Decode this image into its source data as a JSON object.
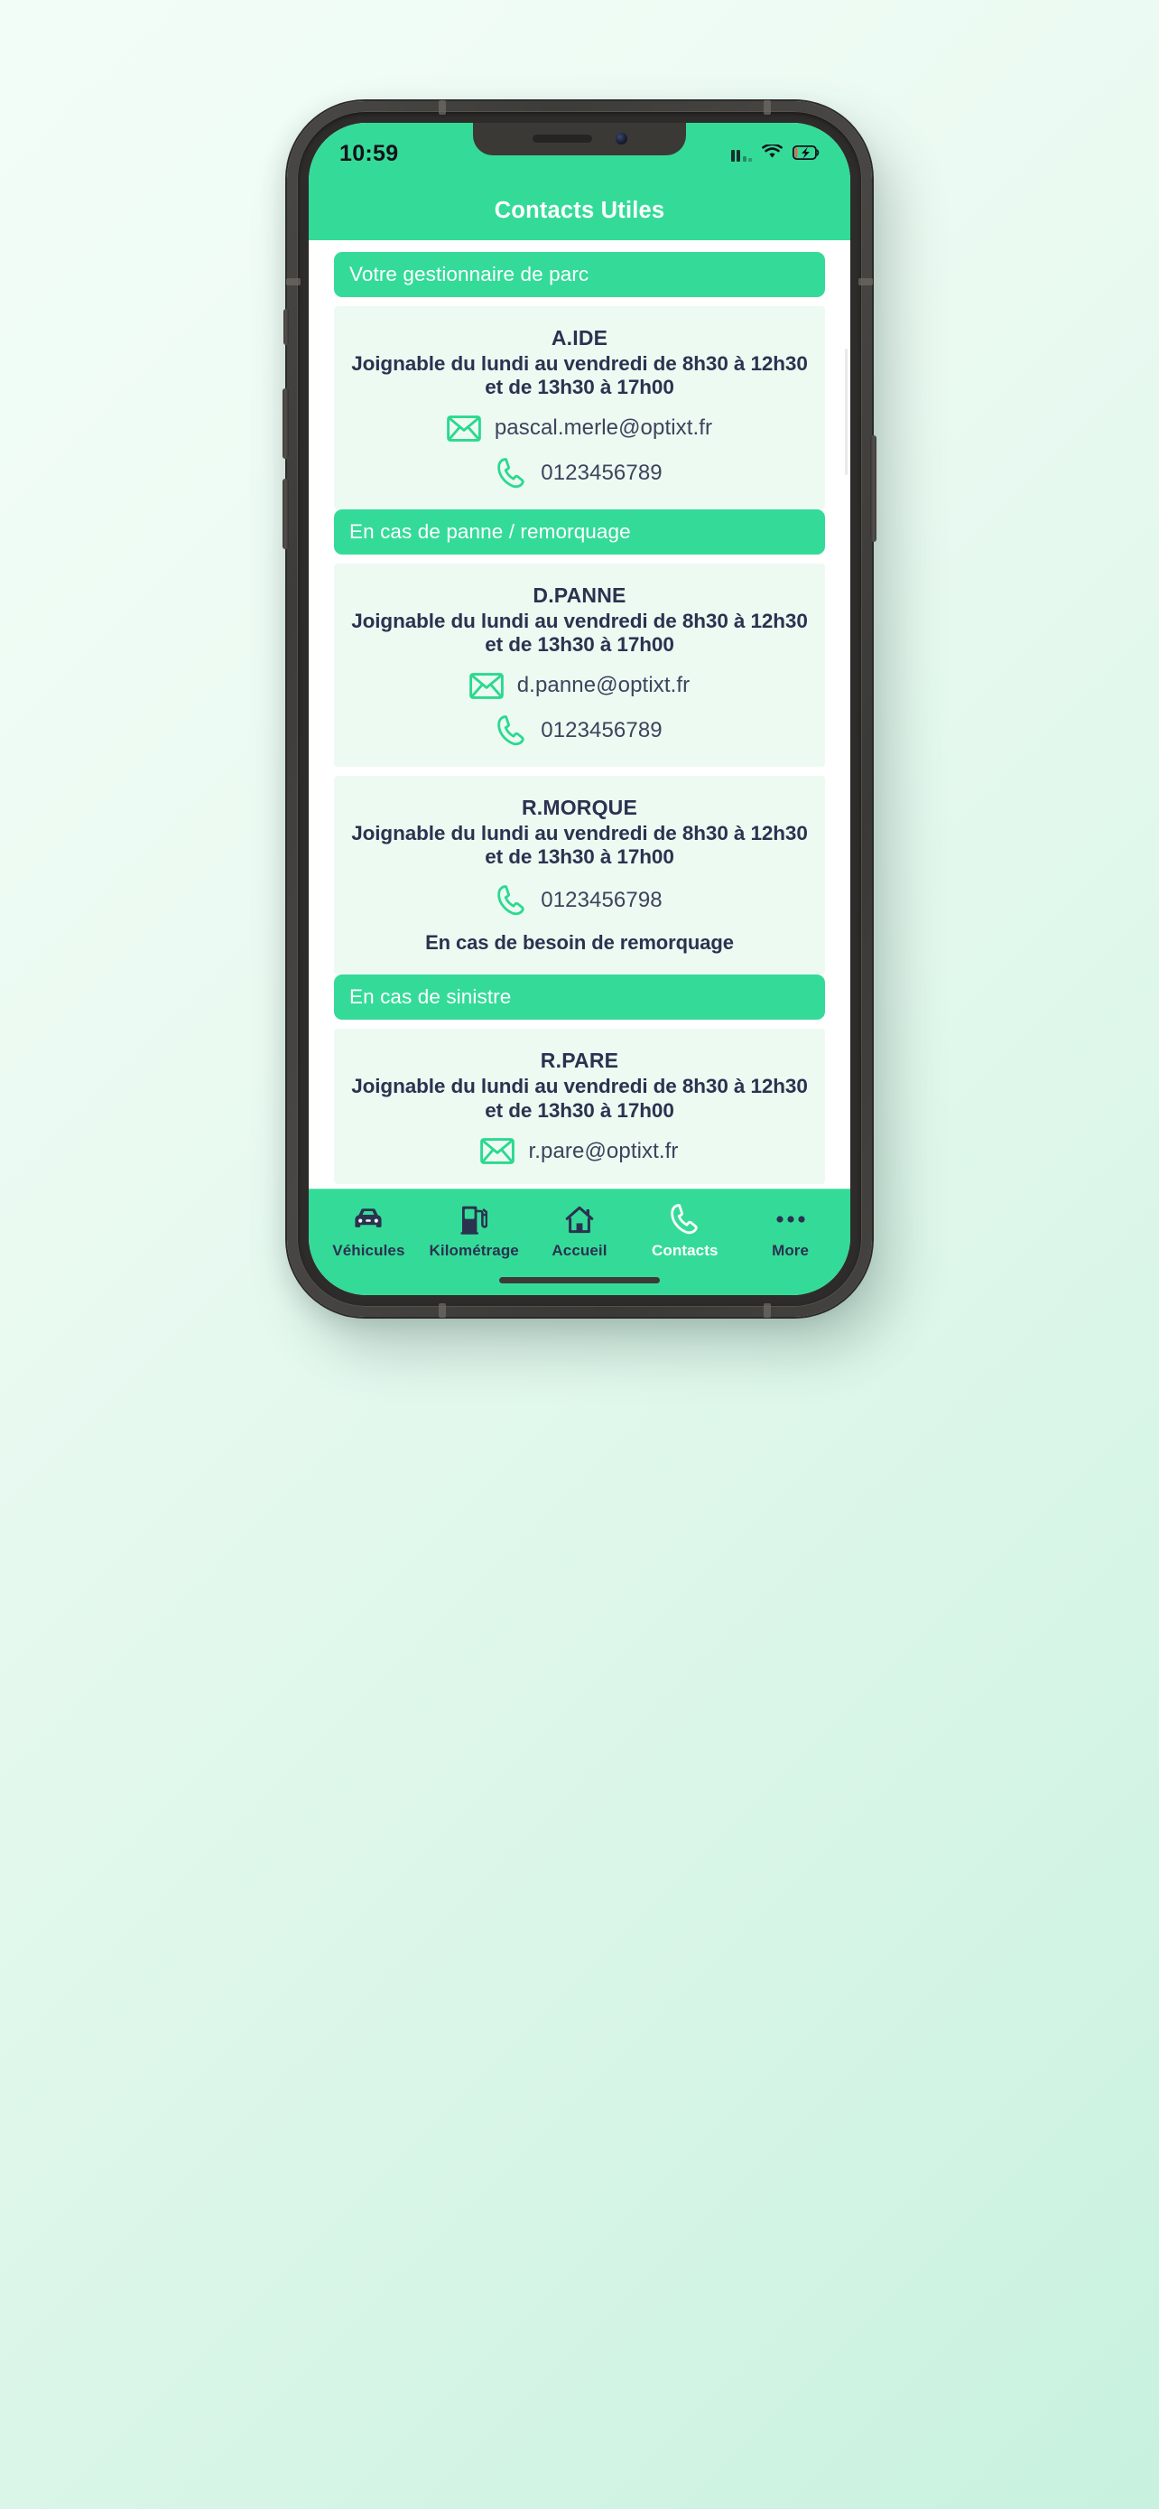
{
  "status_bar": {
    "time": "10:59",
    "signal_icon": "cellular-signal-icon",
    "wifi_icon": "wifi-icon",
    "battery_icon": "battery-charging-icon"
  },
  "header": {
    "title": "Contacts Utiles"
  },
  "colors": {
    "brand_green": "#34db98",
    "card_background": "#edfaf2",
    "text_dark": "#2b3250",
    "text_body": "#3d435c",
    "page_background": "#ffffff"
  },
  "sections": [
    {
      "label": "Votre gestionnaire de parc",
      "cards": [
        {
          "name": "A.IDE",
          "hours": "Joignable du lundi au vendredi de 8h30 à 12h30 et de 13h30 à 17h00",
          "rows": [
            {
              "icon": "envelope-icon",
              "type": "email",
              "value": "pascal.merle@optixt.fr"
            },
            {
              "icon": "phone-icon",
              "type": "phone",
              "value": "0123456789"
            }
          ],
          "note": ""
        }
      ]
    },
    {
      "label": "En cas de panne / remorquage",
      "cards": [
        {
          "name": "D.PANNE",
          "hours": "Joignable du lundi au vendredi de 8h30 à 12h30 et de 13h30 à 17h00",
          "rows": [
            {
              "icon": "envelope-icon",
              "type": "email",
              "value": "d.panne@optixt.fr"
            },
            {
              "icon": "phone-icon",
              "type": "phone",
              "value": "0123456789"
            }
          ],
          "note": ""
        },
        {
          "name": "R.MORQUE",
          "hours": "Joignable du lundi au vendredi de 8h30 à 12h30 et de 13h30 à 17h00",
          "rows": [
            {
              "icon": "phone-icon",
              "type": "phone",
              "value": "0123456798"
            }
          ],
          "note": "En cas de besoin de remorquage"
        }
      ]
    },
    {
      "label": "En cas de sinistre",
      "cards": [
        {
          "name": "R.PARE",
          "hours": "Joignable du lundi au vendredi de 8h30 à 12h30 et de 13h30 à 17h00",
          "rows": [
            {
              "icon": "envelope-icon",
              "type": "email",
              "value": "r.pare@optixt.fr"
            }
          ],
          "note": ""
        }
      ]
    }
  ],
  "tab_bar": {
    "items": [
      {
        "label": "Véhicules",
        "icon": "car-icon",
        "active": false
      },
      {
        "label": "Kilométrage",
        "icon": "fuel-pump-icon",
        "active": false
      },
      {
        "label": "Accueil",
        "icon": "home-icon",
        "active": false
      },
      {
        "label": "Contacts",
        "icon": "phone-icon",
        "active": true
      },
      {
        "label": "More",
        "icon": "ellipsis-icon",
        "active": false
      }
    ]
  }
}
